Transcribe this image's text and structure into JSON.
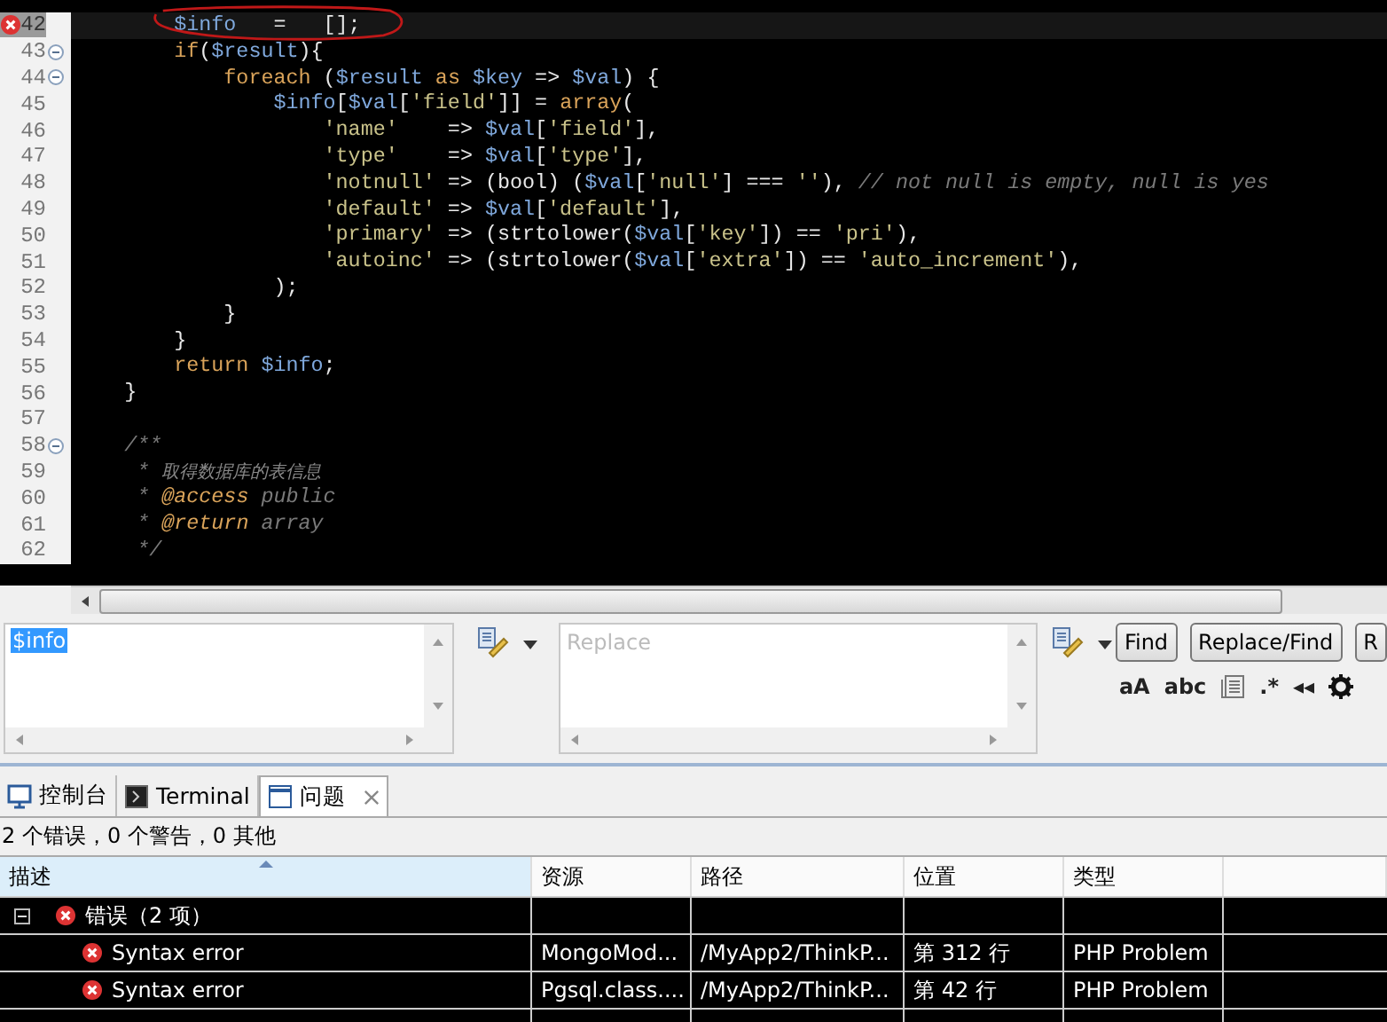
{
  "editor": {
    "lines": [
      {
        "number": "42",
        "error": true,
        "fold": false,
        "current": true,
        "segments": [
          {
            "kind": "var",
            "text": "        $info"
          },
          {
            "kind": "plain",
            "text": "   =   [];"
          }
        ]
      },
      {
        "number": "43",
        "error": false,
        "fold": true,
        "current": false,
        "segments": [
          {
            "kind": "kw",
            "text": "        if"
          },
          {
            "kind": "plain",
            "text": "("
          },
          {
            "kind": "var",
            "text": "$result"
          },
          {
            "kind": "plain",
            "text": "){"
          }
        ]
      },
      {
        "number": "44",
        "error": false,
        "fold": true,
        "current": false,
        "segments": [
          {
            "kind": "kw",
            "text": "            foreach"
          },
          {
            "kind": "plain",
            "text": " ("
          },
          {
            "kind": "var",
            "text": "$result"
          },
          {
            "kind": "kw",
            "text": " as "
          },
          {
            "kind": "var",
            "text": "$key"
          },
          {
            "kind": "plain",
            "text": " => "
          },
          {
            "kind": "var",
            "text": "$val"
          },
          {
            "kind": "plain",
            "text": ") {"
          }
        ]
      },
      {
        "number": "45",
        "error": false,
        "fold": false,
        "current": false,
        "segments": [
          {
            "kind": "var",
            "text": "                $info"
          },
          {
            "kind": "plain",
            "text": "["
          },
          {
            "kind": "var",
            "text": "$val"
          },
          {
            "kind": "plain",
            "text": "["
          },
          {
            "kind": "str",
            "text": "'field'"
          },
          {
            "kind": "plain",
            "text": "]] = "
          },
          {
            "kind": "kw",
            "text": "array"
          },
          {
            "kind": "plain",
            "text": "("
          }
        ]
      },
      {
        "number": "46",
        "error": false,
        "fold": false,
        "current": false,
        "segments": [
          {
            "kind": "str",
            "text": "                    'name'"
          },
          {
            "kind": "plain",
            "text": "    => "
          },
          {
            "kind": "var",
            "text": "$val"
          },
          {
            "kind": "plain",
            "text": "["
          },
          {
            "kind": "str",
            "text": "'field'"
          },
          {
            "kind": "plain",
            "text": "],"
          }
        ]
      },
      {
        "number": "47",
        "error": false,
        "fold": false,
        "current": false,
        "segments": [
          {
            "kind": "str",
            "text": "                    'type'"
          },
          {
            "kind": "plain",
            "text": "    => "
          },
          {
            "kind": "var",
            "text": "$val"
          },
          {
            "kind": "plain",
            "text": "["
          },
          {
            "kind": "str",
            "text": "'type'"
          },
          {
            "kind": "plain",
            "text": "],"
          }
        ]
      },
      {
        "number": "48",
        "error": false,
        "fold": false,
        "current": false,
        "segments": [
          {
            "kind": "str",
            "text": "                    'notnull'"
          },
          {
            "kind": "plain",
            "text": " => (bool) ("
          },
          {
            "kind": "var",
            "text": "$val"
          },
          {
            "kind": "plain",
            "text": "["
          },
          {
            "kind": "str",
            "text": "'null'"
          },
          {
            "kind": "plain",
            "text": "] === "
          },
          {
            "kind": "str",
            "text": "''"
          },
          {
            "kind": "plain",
            "text": "), "
          },
          {
            "kind": "cmt",
            "text": "// not null is empty, null is yes"
          }
        ]
      },
      {
        "number": "49",
        "error": false,
        "fold": false,
        "current": false,
        "segments": [
          {
            "kind": "str",
            "text": "                    'default'"
          },
          {
            "kind": "plain",
            "text": " => "
          },
          {
            "kind": "var",
            "text": "$val"
          },
          {
            "kind": "plain",
            "text": "["
          },
          {
            "kind": "str",
            "text": "'default'"
          },
          {
            "kind": "plain",
            "text": "],"
          }
        ]
      },
      {
        "number": "50",
        "error": false,
        "fold": false,
        "current": false,
        "segments": [
          {
            "kind": "str",
            "text": "                    'primary'"
          },
          {
            "kind": "plain",
            "text": " => (strtolower("
          },
          {
            "kind": "var",
            "text": "$val"
          },
          {
            "kind": "plain",
            "text": "["
          },
          {
            "kind": "str",
            "text": "'key'"
          },
          {
            "kind": "plain",
            "text": "]) == "
          },
          {
            "kind": "str",
            "text": "'pri'"
          },
          {
            "kind": "plain",
            "text": "),"
          }
        ]
      },
      {
        "number": "51",
        "error": false,
        "fold": false,
        "current": false,
        "segments": [
          {
            "kind": "str",
            "text": "                    'autoinc'"
          },
          {
            "kind": "plain",
            "text": " => (strtolower("
          },
          {
            "kind": "var",
            "text": "$val"
          },
          {
            "kind": "plain",
            "text": "["
          },
          {
            "kind": "str",
            "text": "'extra'"
          },
          {
            "kind": "plain",
            "text": "]) == "
          },
          {
            "kind": "str",
            "text": "'auto_increment'"
          },
          {
            "kind": "plain",
            "text": "),"
          }
        ]
      },
      {
        "number": "52",
        "error": false,
        "fold": false,
        "current": false,
        "segments": [
          {
            "kind": "plain",
            "text": "                );"
          }
        ]
      },
      {
        "number": "53",
        "error": false,
        "fold": false,
        "current": false,
        "segments": [
          {
            "kind": "plain",
            "text": "            }"
          }
        ]
      },
      {
        "number": "54",
        "error": false,
        "fold": false,
        "current": false,
        "segments": [
          {
            "kind": "plain",
            "text": "        }"
          }
        ]
      },
      {
        "number": "55",
        "error": false,
        "fold": false,
        "current": false,
        "segments": [
          {
            "kind": "kw",
            "text": "        return "
          },
          {
            "kind": "var",
            "text": "$info"
          },
          {
            "kind": "plain",
            "text": ";"
          }
        ]
      },
      {
        "number": "56",
        "error": false,
        "fold": false,
        "current": false,
        "segments": [
          {
            "kind": "plain",
            "text": "    }"
          }
        ]
      },
      {
        "number": "57",
        "error": false,
        "fold": false,
        "current": false
      },
      {
        "number": "58",
        "error": false,
        "fold": true,
        "current": false,
        "segments": [
          {
            "kind": "cmt",
            "text": "    /**"
          }
        ]
      },
      {
        "number": "59",
        "error": false,
        "fold": false,
        "current": false,
        "segments": [
          {
            "kind": "cmt",
            "text": "     * "
          },
          {
            "kind": "small",
            "text": "取得数据库的表信息"
          }
        ]
      },
      {
        "number": "60",
        "error": false,
        "fold": false,
        "current": false,
        "segments": [
          {
            "kind": "cmt",
            "text": "     * "
          },
          {
            "kind": "tag",
            "text": "@access"
          },
          {
            "kind": "cmt",
            "text": " public"
          }
        ]
      },
      {
        "number": "61",
        "error": false,
        "fold": false,
        "current": false,
        "segments": [
          {
            "kind": "cmt",
            "text": "     * "
          },
          {
            "kind": "tag",
            "text": "@return"
          },
          {
            "kind": "cmt",
            "text": " array"
          }
        ]
      },
      {
        "number": "62",
        "error": false,
        "fold": false,
        "current": false,
        "segments": [
          {
            "kind": "cmt",
            "text": "     */"
          }
        ]
      }
    ]
  },
  "find_replace": {
    "find": {
      "value": "$info"
    },
    "replace": {
      "placeholder": "Replace"
    },
    "buttons": [
      "Find",
      "Replace/Find",
      "R"
    ],
    "options": [
      {
        "kind": "text",
        "label": "aA"
      },
      {
        "kind": "text",
        "label": "abc"
      },
      {
        "kind": "lines"
      },
      {
        "kind": "text",
        "label": ".*"
      },
      {
        "kind": "text",
        "label": "◂◂"
      },
      {
        "kind": "gear"
      }
    ]
  },
  "tabs": [
    {
      "label": "控制台",
      "kind": "console",
      "selected": false
    },
    {
      "label": "Terminal",
      "kind": "terminal",
      "selected": false
    },
    {
      "label": "问题",
      "kind": "problems",
      "selected": true
    }
  ],
  "status": "2 个错误，0 个警告，0 其他",
  "table": {
    "columns": [
      {
        "label": "描述",
        "sorted": true
      },
      {
        "label": "资源",
        "sorted": false
      },
      {
        "label": "路径",
        "sorted": false
      },
      {
        "label": "位置",
        "sorted": false
      },
      {
        "label": "类型",
        "sorted": false
      }
    ],
    "rows": [
      {
        "description": "错误（2 项）",
        "expanded": true,
        "children": [
          {
            "description": "Syntax error",
            "resource": "MongoMod...",
            "path": "/MyApp2/ThinkP...",
            "location": "第 312 行",
            "type": "PHP Problem"
          },
          {
            "description": "Syntax error",
            "resource": "Pgsql.class....",
            "path": "/MyApp2/ThinkP...",
            "location": "第 42 行",
            "type": "PHP Problem"
          }
        ]
      }
    ]
  }
}
